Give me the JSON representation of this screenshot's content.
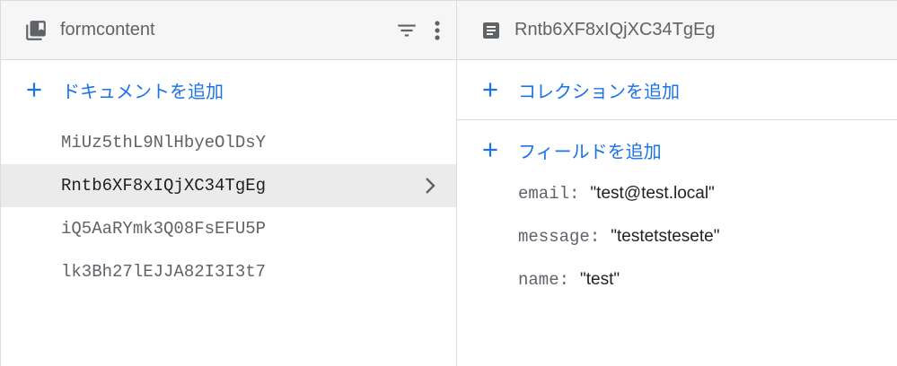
{
  "collection_panel": {
    "title": "formcontent",
    "collection_icon": "collection-stack-icon",
    "filter_icon": "filter-icon",
    "more_icon": "more-vert-icon",
    "add_document_label": "ドキュメントを追加",
    "documents": [
      {
        "id": "MiUz5thL9NlHbyeOlDsY",
        "selected": false
      },
      {
        "id": "Rntb6XF8xIQjXC34TgEg",
        "selected": true
      },
      {
        "id": "iQ5AaRYmk3Q08FsEFU5P",
        "selected": false
      },
      {
        "id": "lk3Bh27lEJJA82I3I3t7",
        "selected": false
      }
    ]
  },
  "document_panel": {
    "title": "Rntb6XF8xIQjXC34TgEg",
    "document_icon": "document-icon",
    "add_collection_label": "コレクションを追加",
    "add_field_label": "フィールドを追加",
    "fields": [
      {
        "key": "email",
        "value": "\"test@test.local\""
      },
      {
        "key": "message",
        "value": "\"testetstesete\""
      },
      {
        "key": "name",
        "value": "\"test\""
      }
    ]
  },
  "colors": {
    "accent": "#1a73e8",
    "header_bg": "#f6f6f6",
    "selected_bg": "#ebebeb",
    "border": "#dadce0",
    "muted_text": "#5f6368"
  }
}
